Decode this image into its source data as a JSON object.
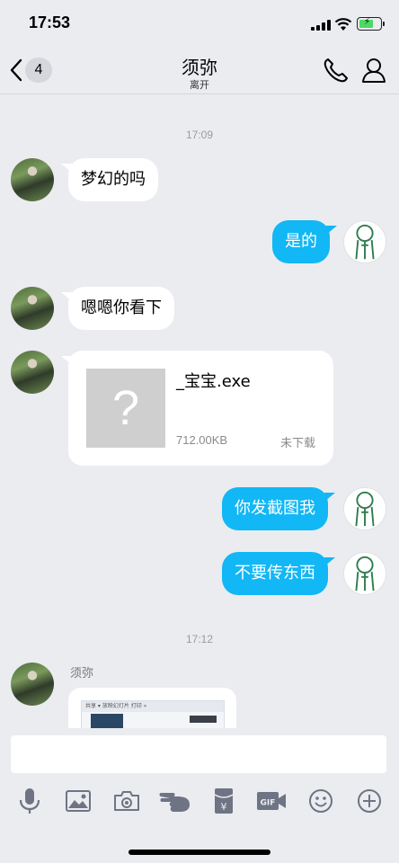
{
  "status_bar": {
    "time": "17:53"
  },
  "nav": {
    "back_count": "4",
    "title": "须弥",
    "subtitle": "离开"
  },
  "messages": {
    "ts1": "17:09",
    "m1": "梦幻的吗",
    "m2": "是的",
    "m3": "嗯嗯你看下",
    "file": {
      "name": "_宝宝.exe",
      "size": "712.00KB",
      "state": "未下载",
      "thumb_glyph": "?"
    },
    "m5": "你发截图我",
    "m6": "不要传东西",
    "ts2": "17:12",
    "sender_name": "须弥",
    "image_preview": {
      "tabs": "共享 ▾   放映幻灯片   打印   »"
    }
  },
  "input": {
    "value": "",
    "placeholder": ""
  },
  "toolbar_icons": [
    "microphone-icon",
    "image-icon",
    "camera-icon",
    "poke-icon",
    "red-packet-icon",
    "gif-icon",
    "emoji-icon",
    "plus-icon"
  ],
  "colors": {
    "bubble_self": "#12b7f5",
    "background": "#ebecf0"
  }
}
